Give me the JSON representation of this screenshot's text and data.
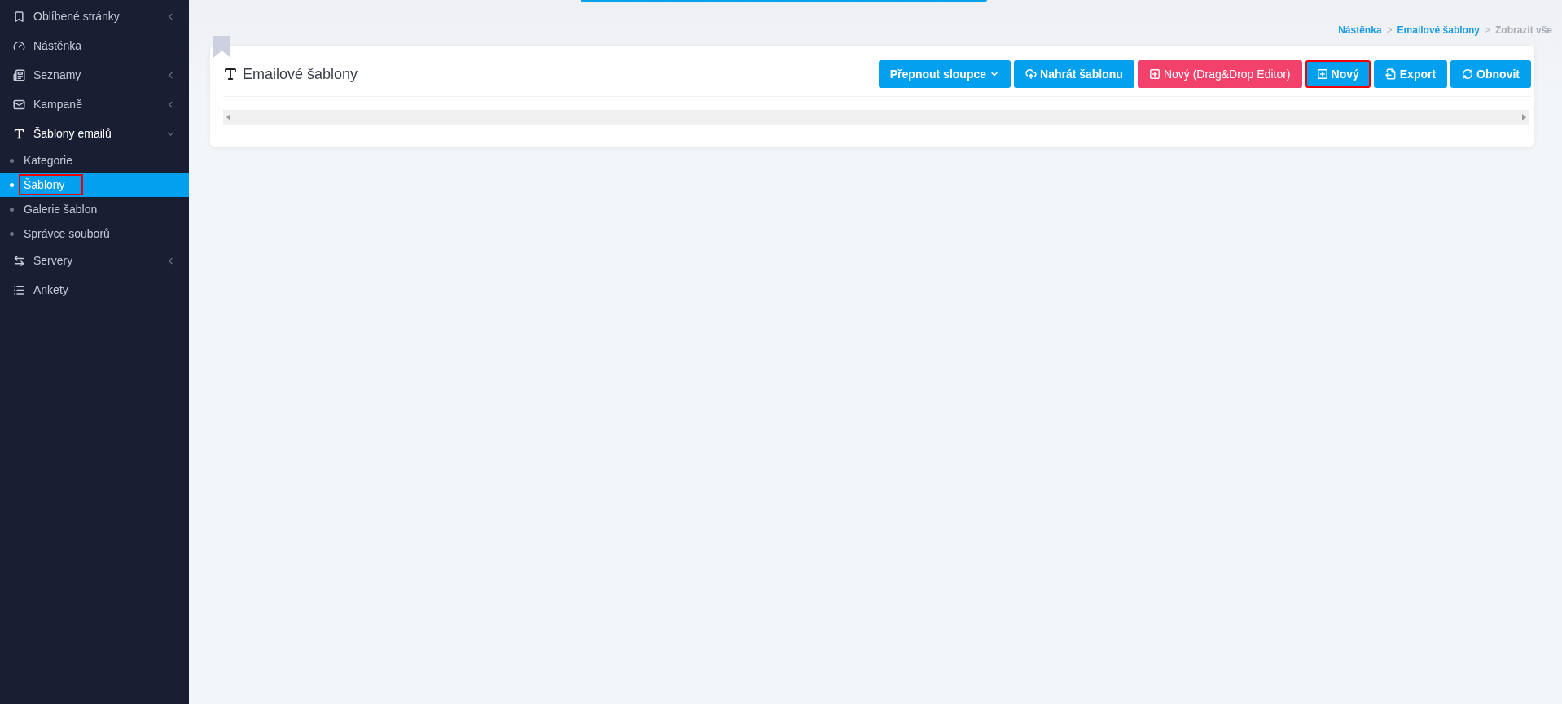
{
  "sidebar": {
    "items": [
      {
        "label": "Oblíbené stránky",
        "expanded": false
      },
      {
        "label": "Nástěnka"
      },
      {
        "label": "Seznamy",
        "expanded": false
      },
      {
        "label": "Kampaně",
        "expanded": false
      },
      {
        "label": "Šablony emailů",
        "expanded": true,
        "children": [
          {
            "label": "Kategorie",
            "selected": false,
            "highlighted": false
          },
          {
            "label": "Šablony",
            "selected": true,
            "highlighted": true
          },
          {
            "label": "Galerie šablon",
            "selected": false,
            "highlighted": false
          },
          {
            "label": "Správce souborů",
            "selected": false,
            "highlighted": false
          }
        ]
      },
      {
        "label": "Servery",
        "expanded": false
      },
      {
        "label": "Ankety"
      }
    ]
  },
  "breadcrumb": [
    {
      "label": "Nástěnka",
      "kind": "link"
    },
    {
      "label": "Emailové šablony",
      "kind": "link"
    },
    {
      "label": "Zobrazit vše",
      "kind": "current"
    }
  ],
  "breadcrumb_separator": ">",
  "card": {
    "title": "Emailové šablony",
    "buttons": [
      {
        "label": "Přepnout sloupce",
        "kind": "primary",
        "highlighted": false
      },
      {
        "label": "Nahrát šablonu",
        "kind": "primary",
        "highlighted": false
      },
      {
        "label": "Nový (Drag&Drop Editor)",
        "kind": "danger",
        "highlighted": false
      },
      {
        "label": "Nový",
        "kind": "primary",
        "highlighted": true
      },
      {
        "label": "Export",
        "kind": "primary",
        "highlighted": false
      },
      {
        "label": "Obnovit",
        "kind": "primary",
        "highlighted": false
      }
    ]
  }
}
